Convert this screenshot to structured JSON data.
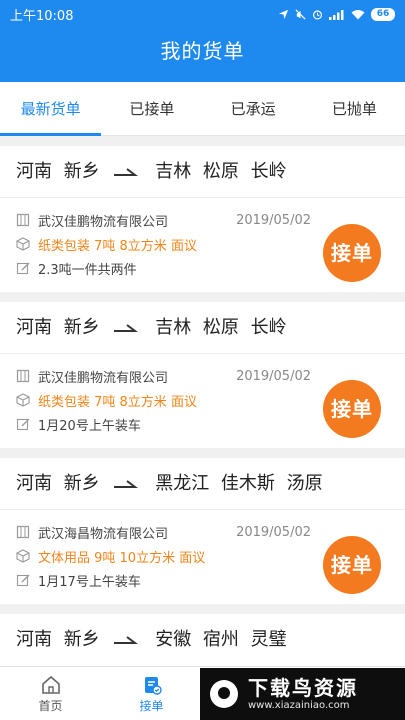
{
  "status_bar": {
    "time": "上午10:08",
    "battery": "66"
  },
  "header": {
    "title": "我的货单"
  },
  "tabs": [
    {
      "label": "最新货单",
      "active": true
    },
    {
      "label": "已接单",
      "active": false
    },
    {
      "label": "已承运",
      "active": false
    },
    {
      "label": "已抛单",
      "active": false
    }
  ],
  "orders": [
    {
      "from": "河南  新乡",
      "to": "吉林  松原  长岭",
      "company": "武汉佳鹏物流有限公司",
      "date": "2019/05/02",
      "cargo": "纸类包装  7吨  8立方米  面议",
      "note": "2.3吨一件共两件",
      "button": "接单"
    },
    {
      "from": "河南  新乡",
      "to": "吉林  松原  长岭",
      "company": "武汉佳鹏物流有限公司",
      "date": "2019/05/02",
      "cargo": "纸类包装  7吨  8立方米  面议",
      "note": "1月20号上午装车",
      "button": "接单"
    },
    {
      "from": "河南  新乡",
      "to": "黑龙江  佳木斯  汤原",
      "company": "武汉海昌物流有限公司",
      "date": "2019/05/02",
      "cargo": "文体用品  9吨  10立方米  面议",
      "note": "1月17号上午装车",
      "button": "接单"
    },
    {
      "from": "河南  新乡",
      "to": "安徽  宿州  灵璧"
    }
  ],
  "bottom_nav": [
    {
      "label": "首页",
      "icon": "home-icon",
      "active": false
    },
    {
      "label": "接单",
      "icon": "order-icon",
      "active": true
    }
  ],
  "watermark": {
    "title": "下载鸟资源",
    "url": "www.xiazainiao.com"
  },
  "colors": {
    "primary": "#1e8af0",
    "accent": "#f47a1f",
    "cargo": "#f08519"
  }
}
